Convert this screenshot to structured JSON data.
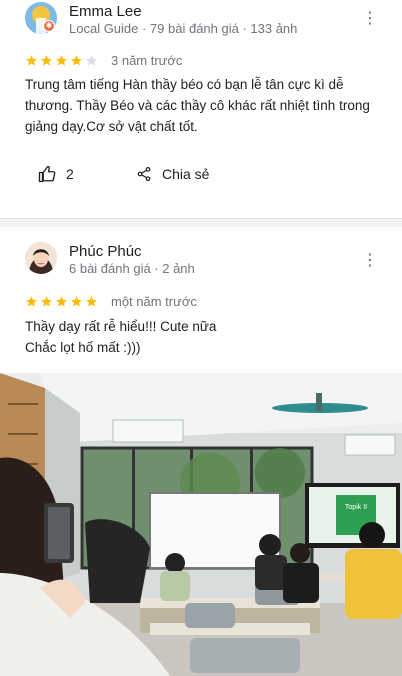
{
  "reviews": [
    {
      "name": "Emma Lee",
      "meta": "Local Guide · 79 bài đánh giá · 133 ảnh",
      "rating": 4,
      "when": "3 năm trước",
      "text": "Trung tâm tiếng Hàn thầy béo có bạn lễ tân cực kì dễ thương. Thầy Béo và các thầy cô khác rất nhiệt tình trong giảng dạy.Cơ sở vật chất tốt.",
      "like_count": "2",
      "share_label": "Chia sẻ"
    },
    {
      "name": "Phúc Phúc",
      "meta": "6 bài đánh giá · 2 ảnh",
      "rating": 5,
      "when": "một năm trước",
      "text_line1": "Thầy dạy rất rễ hiểu!!! Cute nữa",
      "text_line2": "Chắc lọt hố mất :)))"
    }
  ],
  "photo_screen_text": "Topik II",
  "colors": {
    "star": "#fbbc04",
    "star_empty": "#dadce0",
    "meta": "#70757a"
  }
}
